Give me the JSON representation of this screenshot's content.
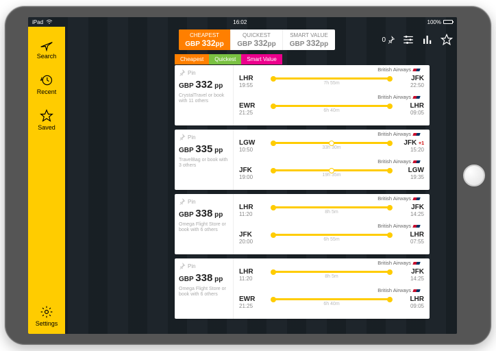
{
  "status": {
    "device": "iPad",
    "wifi": "wifi",
    "time": "16:02",
    "battery_pct": "100%"
  },
  "sidebar": {
    "items": [
      {
        "icon": "plane-icon",
        "label": "Search"
      },
      {
        "icon": "clock-icon",
        "label": "Recent"
      },
      {
        "icon": "star-icon",
        "label": "Saved"
      }
    ],
    "settings": {
      "icon": "gear-icon",
      "label": "Settings"
    }
  },
  "header": {
    "sort_tabs": [
      {
        "title": "CHEAPEST",
        "currency": "GBP",
        "amount": "332",
        "suffix": "pp",
        "active": true
      },
      {
        "title": "QUICKEST",
        "currency": "GBP",
        "amount": "332",
        "suffix": "pp",
        "active": false
      },
      {
        "title": "SMART VALUE",
        "currency": "GBP",
        "amount": "332",
        "suffix": "pp",
        "active": false
      }
    ],
    "pin_count": "0",
    "icons": {
      "sliders": "sliders-icon",
      "bars": "bars-icon",
      "star": "star-icon"
    }
  },
  "chips": [
    {
      "label": "Cheapest",
      "class": "cheapest"
    },
    {
      "label": "Quickest",
      "class": "quickest"
    },
    {
      "label": "Smart Value",
      "class": "smart"
    }
  ],
  "results": [
    {
      "pin_label": "Pin",
      "currency": "GBP",
      "amount": "332",
      "suffix": "pp",
      "agent": "CrystalTravel or book with 11 others",
      "legs": [
        {
          "from_code": "LHR",
          "from_time": "19:55",
          "to_code": "JFK",
          "to_time": "22:50",
          "duration": "7h 55m",
          "airline": "British Airways",
          "stops": 0
        },
        {
          "from_code": "EWR",
          "from_time": "21:25",
          "to_code": "LHR",
          "to_time": "09:05",
          "duration": "6h 40m",
          "airline": "British Airways",
          "stops": 0
        }
      ]
    },
    {
      "pin_label": "Pin",
      "currency": "GBP",
      "amount": "335",
      "suffix": "pp",
      "agent": "TravelBag or book with 3 others",
      "legs": [
        {
          "from_code": "LGW",
          "from_time": "10:50",
          "to_code": "JFK",
          "to_time": "15:20",
          "to_extra": "+1",
          "duration": "33h 30m",
          "airline": "British Airways",
          "stops": 1
        },
        {
          "from_code": "JFK",
          "from_time": "19:00",
          "to_code": "LGW",
          "to_time": "19:35",
          "duration": "19h 35m",
          "airline": "British Airways",
          "stops": 1
        }
      ]
    },
    {
      "pin_label": "Pin",
      "currency": "GBP",
      "amount": "338",
      "suffix": "pp",
      "agent": "Omega Flight Store or book with 6 others",
      "legs": [
        {
          "from_code": "LHR",
          "from_time": "11:20",
          "to_code": "JFK",
          "to_time": "14:25",
          "duration": "8h 5m",
          "airline": "British Airways",
          "stops": 0
        },
        {
          "from_code": "JFK",
          "from_time": "20:00",
          "to_code": "LHR",
          "to_time": "07:55",
          "duration": "6h 55m",
          "airline": "British Airways",
          "stops": 0
        }
      ]
    },
    {
      "pin_label": "Pin",
      "currency": "GBP",
      "amount": "338",
      "suffix": "pp",
      "agent": "Omega Flight Store or book with 6 others",
      "legs": [
        {
          "from_code": "LHR",
          "from_time": "11:20",
          "to_code": "JFK",
          "to_time": "14:25",
          "duration": "8h 5m",
          "airline": "British Airways",
          "stops": 0
        },
        {
          "from_code": "EWR",
          "from_time": "21:25",
          "to_code": "LHR",
          "to_time": "09:05",
          "duration": "6h 40m",
          "airline": "British Airways",
          "stops": 0
        }
      ]
    }
  ]
}
